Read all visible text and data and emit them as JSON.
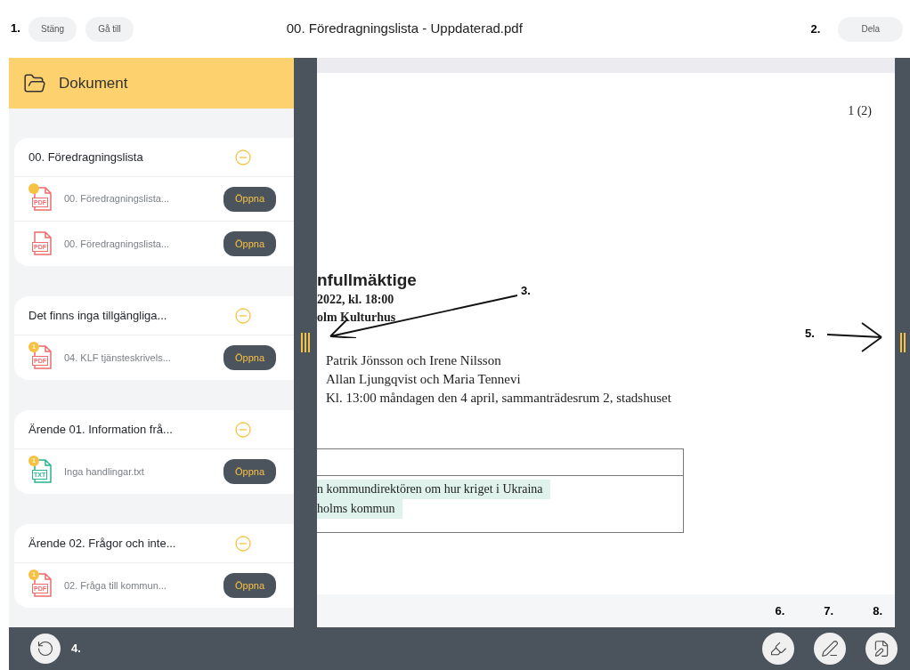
{
  "top_bar": {
    "marker": "1.",
    "buttons": [
      "Stäng",
      "Gå till"
    ],
    "title": "00. Föredragningslista - Uppdaterad.pdf",
    "share_marker": "2.",
    "share_button": "Dela"
  },
  "sidebar": {
    "title": "Dokument",
    "groups": [
      {
        "title": "00. Föredragningslista",
        "expanded": true,
        "files": [
          {
            "type": "PDF",
            "name": "00. Föredragningslista...",
            "badge": {
              "kind": "dot"
            },
            "button": "Öppna"
          },
          {
            "type": "PDF",
            "name": "00. Föredragningslista...",
            "button": "Öppna"
          }
        ]
      },
      {
        "title": "Det finns inga tillgängliga...",
        "expanded": true,
        "files": [
          {
            "type": "PDF",
            "name": "04. KLF tjänsteskrivels...",
            "badge": {
              "kind": "count",
              "text": "1"
            },
            "button": "Öppna"
          }
        ]
      },
      {
        "title": "Ärende 01. Information frå...",
        "expanded": true,
        "files": [
          {
            "type": "TXT",
            "name": "Inga handlingar.txt",
            "badge": {
              "kind": "count",
              "text": "1"
            },
            "button": "Öppna"
          }
        ]
      },
      {
        "title": "Ärende 02. Frågor och inte...",
        "expanded": true,
        "files": [
          {
            "type": "PDF",
            "name": "02. Fråga till kommun...",
            "badge": {
              "kind": "count",
              "text": "1"
            },
            "button": "Öppna"
          }
        ]
      }
    ]
  },
  "document": {
    "page_number": "1 (2)",
    "heading": "nfullmäktige",
    "lines_bold": [
      "2022, kl. 18:00",
      "olm Kulturhus"
    ],
    "lines": [
      "Patrik Jönsson och Irene Nilsson",
      "Allan Ljungqvist och Maria Tennevi",
      "Kl. 13:00 måndagen den 4 april, sammanträdesrum 2, stadshuset"
    ],
    "table_rows": [
      {
        "text": "n kommundirektören om hur kriget i Ukraina",
        "highlighted": true
      },
      {
        "text": "holms kommun",
        "highlighted": true
      }
    ],
    "annotations": [
      "3.",
      "5."
    ],
    "tool_markers": [
      "6.",
      "7.",
      "8."
    ]
  },
  "bottom_bar": {
    "marker": "4.",
    "tools": [
      {
        "kind": "highlighter"
      },
      {
        "kind": "pen"
      },
      {
        "kind": "notes"
      }
    ]
  }
}
